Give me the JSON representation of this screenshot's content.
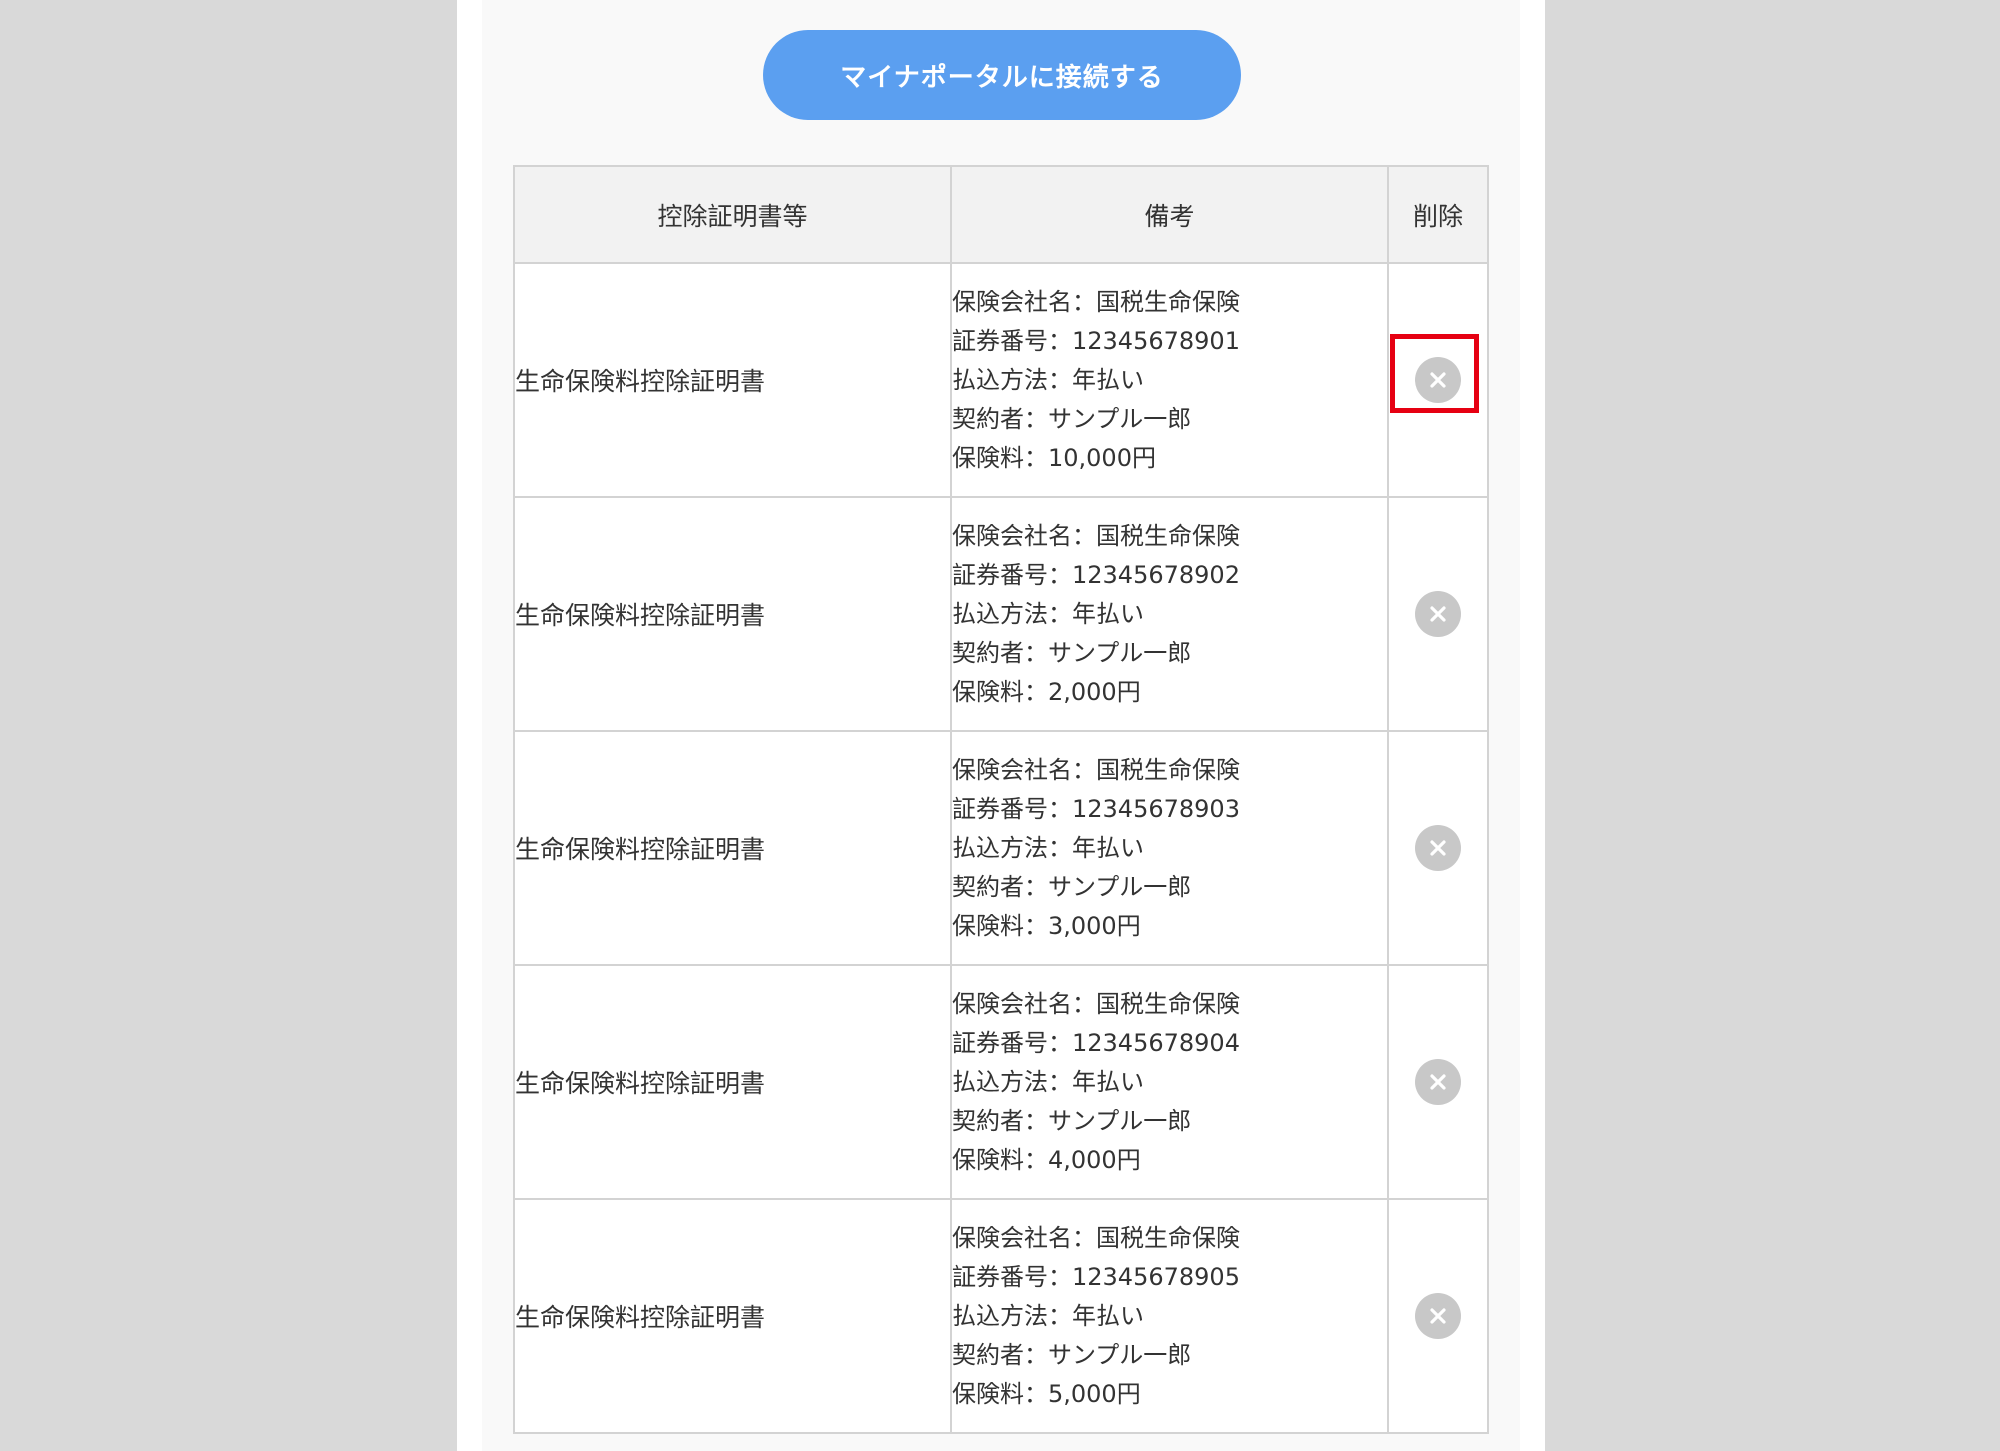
{
  "connect_button": {
    "label": "マイナポータルに接続する"
  },
  "table": {
    "headers": [
      "控除証明書等",
      "備考",
      "削除"
    ],
    "rows": [
      {
        "certificate": "生命保険料控除証明書",
        "remarks": [
          "保険会社名：国税生命保険",
          "証券番号：12345678901",
          "払込方法：年払い",
          "契約者：サンプル一郎",
          "保険料：10,000円"
        ],
        "delete_icon": "close-circle-icon"
      },
      {
        "certificate": "生命保険料控除証明書",
        "remarks": [
          "保険会社名：国税生命保険",
          "証券番号：12345678902",
          "払込方法：年払い",
          "契約者：サンプル一郎",
          "保険料：2,000円"
        ],
        "delete_icon": "close-circle-icon"
      },
      {
        "certificate": "生命保険料控除証明書",
        "remarks": [
          "保険会社名：国税生命保険",
          "証券番号：12345678903",
          "払込方法：年払い",
          "契約者：サンプル一郎",
          "保険料：3,000円"
        ],
        "delete_icon": "close-circle-icon"
      },
      {
        "certificate": "生命保険料控除証明書",
        "remarks": [
          "保険会社名：国税生命保険",
          "証券番号：12345678904",
          "払込方法：年払い",
          "契約者：サンプル一郎",
          "保険料：4,000円"
        ],
        "delete_icon": "close-circle-icon"
      },
      {
        "certificate": "生命保険料控除証明書",
        "remarks": [
          "保険会社名：国税生命保険",
          "証券番号：12345678905",
          "払込方法：年払い",
          "契約者：サンプル一郎",
          "保険料：5,000円"
        ],
        "delete_icon": "close-circle-icon"
      }
    ]
  },
  "colors": {
    "button_blue": "#5b9ff0",
    "highlight_red": "#e60012",
    "delete_icon_gray": "#c8c8c8",
    "header_bg": "#f2f2f2",
    "border": "#d3d3d3"
  }
}
